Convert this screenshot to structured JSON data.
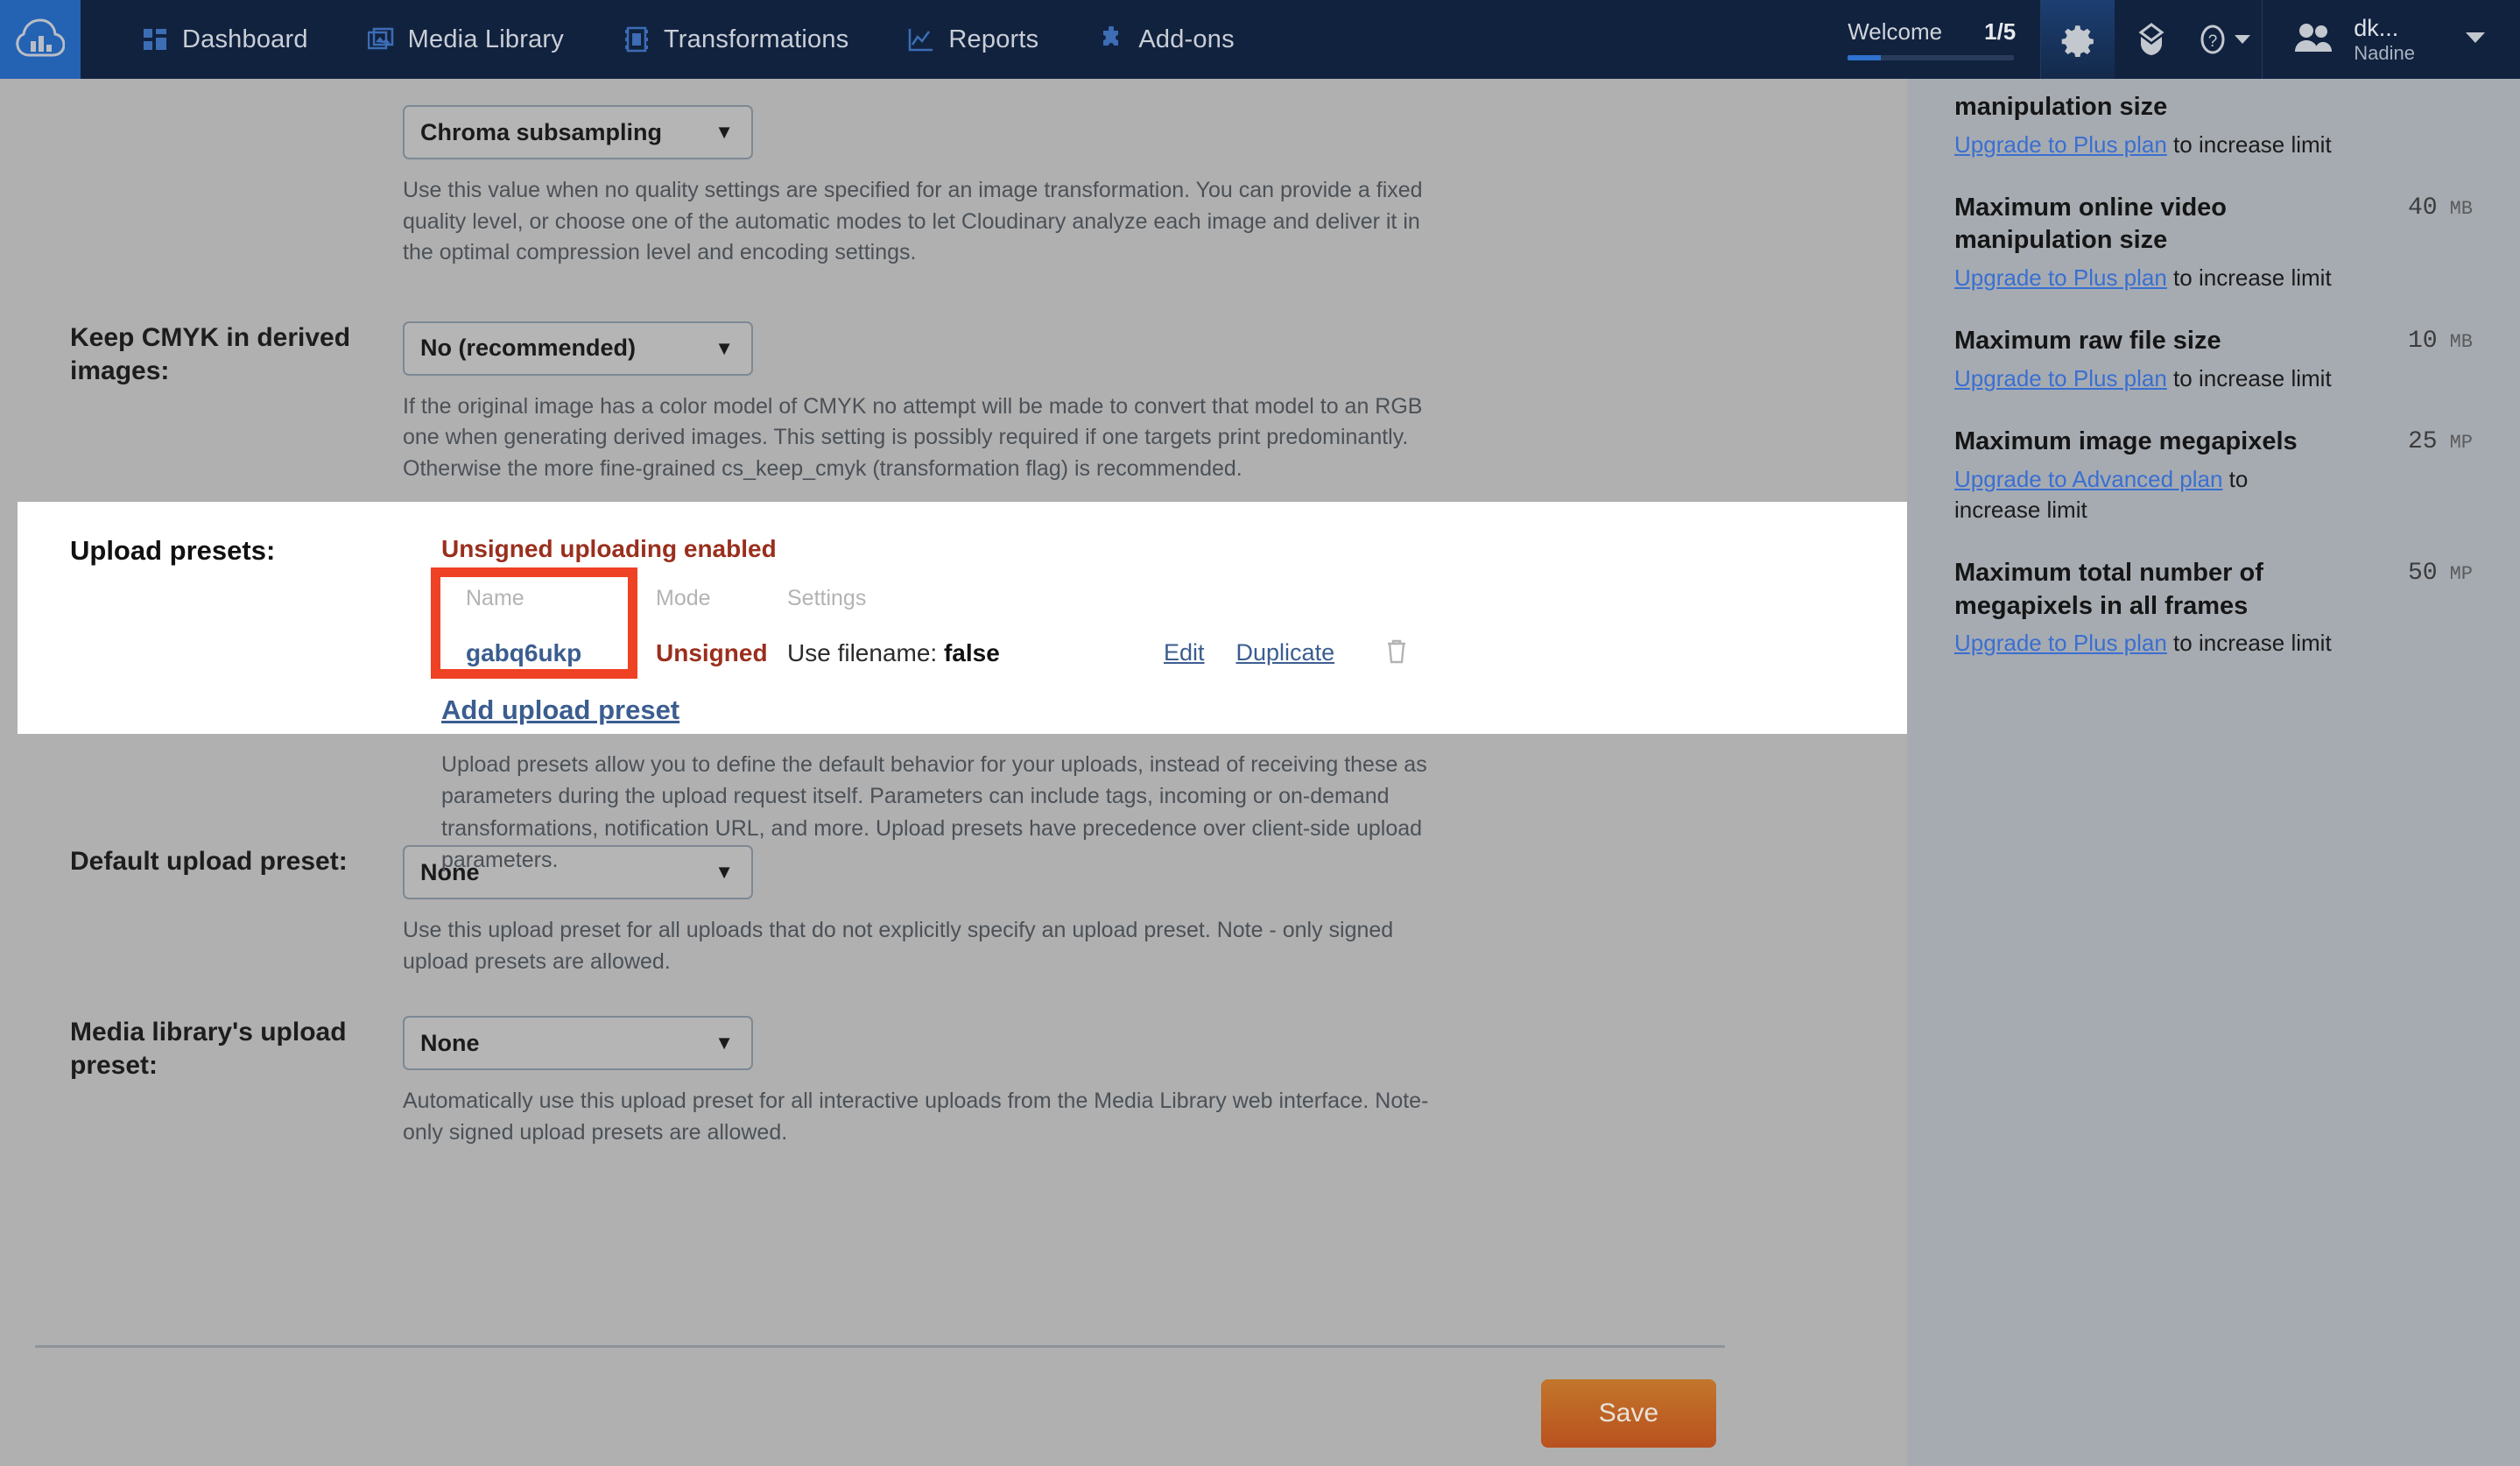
{
  "nav": {
    "logo": "cloudinary-logo-icon",
    "items": [
      {
        "label": "Dashboard",
        "icon": "dashboard-icon"
      },
      {
        "label": "Media Library",
        "icon": "media-library-icon"
      },
      {
        "label": "Transformations",
        "icon": "transformations-icon"
      },
      {
        "label": "Reports",
        "icon": "reports-icon"
      },
      {
        "label": "Add-ons",
        "icon": "addons-icon"
      }
    ],
    "welcome": {
      "label": "Welcome",
      "count": "1/5",
      "progress_percent": 20
    },
    "icons": [
      {
        "name": "gear-icon",
        "active": true
      },
      {
        "name": "box-icon",
        "active": false
      },
      {
        "name": "help-icon",
        "active": false,
        "caret": true
      }
    ],
    "user": {
      "top": "dk...",
      "bottom": "Nadine",
      "avatar": "people-icon"
    }
  },
  "form": {
    "chroma": {
      "select_value": "Chroma subsampling",
      "help": "Use this value when no quality settings are specified for an image transformation. You can provide a fixed quality level, or choose one of the automatic modes to let Cloudinary analyze each image and deliver it in the optimal compression level and encoding settings."
    },
    "cmyk": {
      "label": "Keep CMYK in derived images:",
      "select_value": "No (recommended)",
      "help": "If the original image has a color model of CMYK no attempt will be made to convert that model to an RGB one when generating derived images. This setting is possibly required if one targets print predominantly. Otherwise the more fine-grained cs_keep_cmyk (transformation flag) is recommended."
    },
    "upload_presets": {
      "label": "Upload presets:",
      "status": "Unsigned uploading enabled",
      "headers": {
        "name": "Name",
        "mode": "Mode",
        "settings": "Settings"
      },
      "rows": [
        {
          "name": "gabq6ukp",
          "mode": "Unsigned",
          "settings_key": "Use filename:",
          "settings_value": "false",
          "edit": "Edit",
          "duplicate": "Duplicate",
          "delete_icon": "trash-icon"
        }
      ],
      "add_link": "Add upload preset",
      "help": "Upload presets allow you to define the default behavior for your uploads, instead of receiving these as parameters during the upload request itself. Parameters can include tags, incoming or on-demand transformations, notification URL, and more. Upload presets have precedence over client-side upload parameters.",
      "highlight_color": "#ef4123"
    },
    "default_preset": {
      "label": "Default upload preset:",
      "select_value": "None",
      "help": "Use this upload preset for all uploads that do not explicitly specify an upload preset. Note - only signed upload presets are allowed."
    },
    "media_library_preset": {
      "label": "Media library's upload preset:",
      "select_value": "None",
      "help": "Automatically use this upload preset for all interactive uploads from the Media Library web interface. Note- only signed upload presets are allowed."
    },
    "save_label": "Save"
  },
  "sidebar": {
    "limits": [
      {
        "title": "manipulation size",
        "value": "",
        "unit": "",
        "link": "Upgrade to Plus plan",
        "suffix": " to increase limit"
      },
      {
        "title": "Maximum online video manipulation size",
        "value": "40",
        "unit": "MB",
        "link": "Upgrade to Plus plan",
        "suffix": " to increase limit"
      },
      {
        "title": "Maximum raw file size",
        "value": "10",
        "unit": "MB",
        "link": "Upgrade to Plus plan",
        "suffix": " to increase limit"
      },
      {
        "title": "Maximum image megapixels",
        "value": "25",
        "unit": "MP",
        "link": "Upgrade to Advanced plan",
        "suffix": " to increase limit"
      },
      {
        "title": "Maximum total number of megapixels in all frames",
        "value": "50",
        "unit": "MP",
        "link": "Upgrade to Plus plan",
        "suffix": " to increase limit"
      }
    ]
  }
}
